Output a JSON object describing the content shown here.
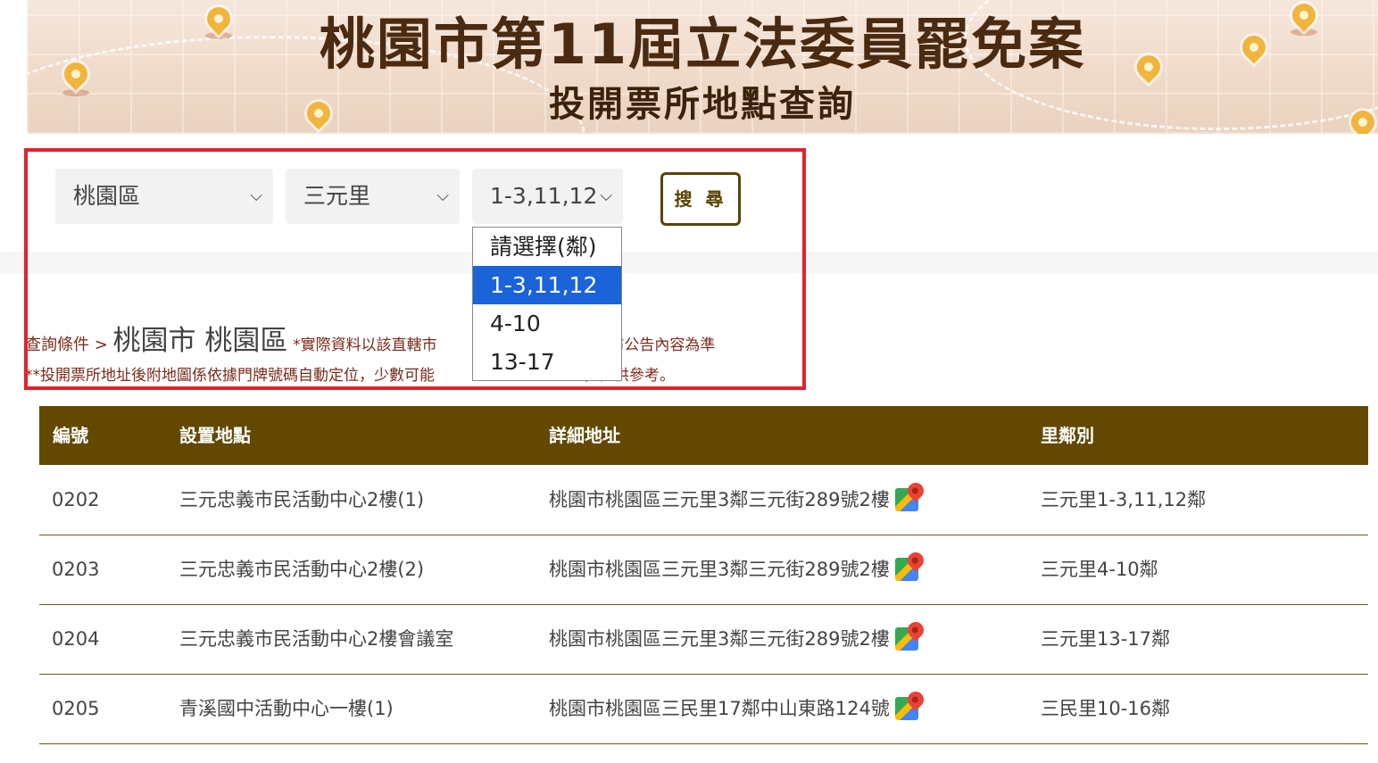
{
  "banner": {
    "title": "桃園市第11屆立法委員罷免案",
    "subtitle": "投開票所地點查詢"
  },
  "search": {
    "district": "桃園區",
    "village": "三元里",
    "neighborhood": "1-3,11,12",
    "button_label": "搜 尋"
  },
  "dropdown": {
    "options": [
      {
        "label": "請選擇(鄰)"
      },
      {
        "label": "1-3,11,12"
      },
      {
        "label": "4-10"
      },
      {
        "label": "13-17"
      }
    ],
    "selected_index": 1
  },
  "query": {
    "prefix": "查詢條件 >",
    "location": "桃園市 桃園區",
    "note_left": "*實際資料以該直轄市",
    "note_right": "發布公告內容為準",
    "map_note_left": "**投開票所地址後附地圖係依據門牌號碼自動定位，少數可能",
    "map_note_right": "差，僅供參考。"
  },
  "table": {
    "headers": {
      "id": "編號",
      "place": "設置地點",
      "address": "詳細地址",
      "neighborhood": "里鄰別"
    },
    "rows": [
      {
        "id": "0202",
        "place": "三元忠義市民活動中心2樓(1)",
        "address": "桃園市桃園區三元里3鄰三元街289號2樓",
        "neighborhood": "三元里1-3,11,12鄰"
      },
      {
        "id": "0203",
        "place": "三元忠義市民活動中心2樓(2)",
        "address": "桃園市桃園區三元里3鄰三元街289號2樓",
        "neighborhood": "三元里4-10鄰"
      },
      {
        "id": "0204",
        "place": "三元忠義市民活動中心2樓會議室",
        "address": "桃園市桃園區三元里3鄰三元街289號2樓",
        "neighborhood": "三元里13-17鄰"
      },
      {
        "id": "0205",
        "place": "青溪國中活動中心一樓(1)",
        "address": "桃園市桃園區三民里17鄰中山東路124號",
        "neighborhood": "三民里10-16鄰"
      }
    ]
  },
  "colors": {
    "table_header": "#624800",
    "highlight": "#e0222e",
    "selected_option": "#1a63d8",
    "banner_title": "#4a2a10"
  },
  "icons": {
    "chevron": "chevron-down-icon",
    "map": "google-maps-icon",
    "pin": "map-pin-icon"
  }
}
